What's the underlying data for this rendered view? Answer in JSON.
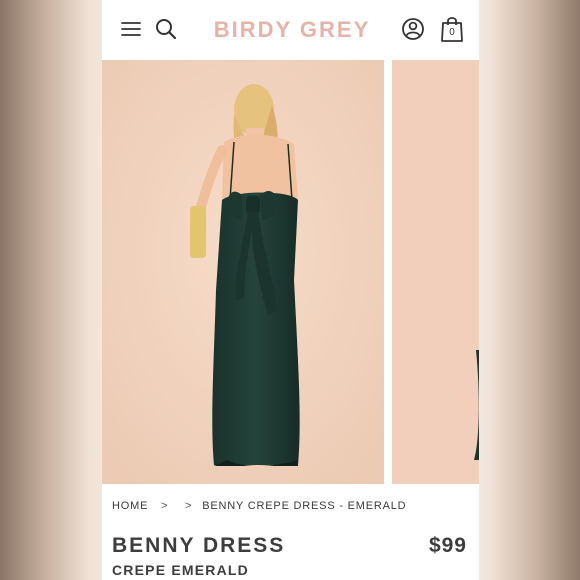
{
  "header": {
    "brand": "BIRDY GREY",
    "cart_count": "0",
    "icons": [
      "hamburger-menu-icon",
      "search-icon",
      "account-icon",
      "shopping-bag-icon"
    ]
  },
  "breadcrumb": {
    "home": "HOME",
    "separator": ">",
    "current": "BENNY CREPE DRESS - EMERALD"
  },
  "product": {
    "title": "BENNY DRESS",
    "subtitle": "CREPE EMERALD",
    "price": "$99"
  },
  "colors": {
    "brand": "#e7b2a8",
    "dress": "#1f3a33",
    "backdrop": "#f2d3be",
    "text": "#3d3d3d"
  }
}
